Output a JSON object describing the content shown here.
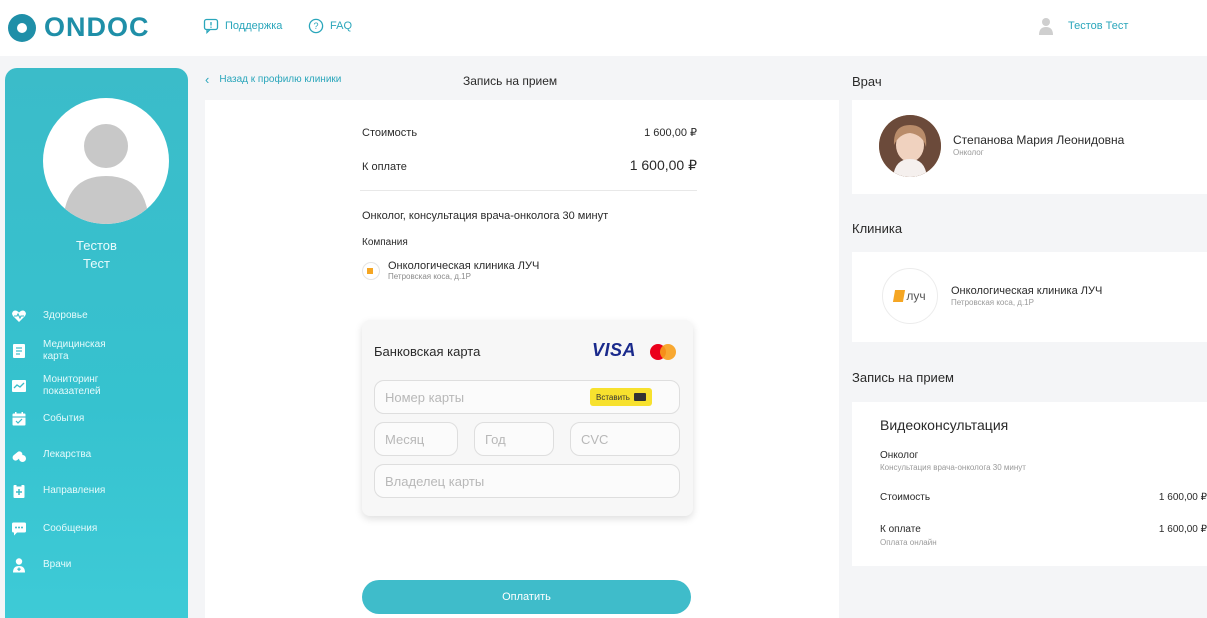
{
  "header": {
    "logo": "ONDOC",
    "support": "Поддержка",
    "faq": "FAQ",
    "user": "Тестов Тест"
  },
  "sidebar": {
    "user_first": "Тестов",
    "user_last": "Тест",
    "items": [
      {
        "label": "Здоровье",
        "icon": "heart-icon"
      },
      {
        "label": "Медицинская карта",
        "icon": "medical-card-icon"
      },
      {
        "label": "Мониторинг показателей",
        "icon": "monitoring-icon"
      },
      {
        "label": "События",
        "icon": "calendar-icon"
      },
      {
        "label": "Лекарства",
        "icon": "pills-icon"
      },
      {
        "label": "Направления",
        "icon": "clipboard-icon"
      },
      {
        "label": "Сообщения",
        "icon": "chat-icon"
      },
      {
        "label": "Врачи",
        "icon": "doctor-icon"
      }
    ]
  },
  "center": {
    "back": "Назад к профилю клиники",
    "title": "Запись на прием",
    "cost_label": "Стоимость",
    "cost_value": "1 600,00 ₽",
    "pay_label": "К оплате",
    "pay_value": "1 600,00 ₽",
    "service": "Онколог, консультация врача-онколога 30 минут",
    "company_label": "Компания",
    "company_name": "Онкологическая клиника ЛУЧ",
    "company_address": "Петровская коса, д.1Р",
    "bank_card": {
      "title": "Банковская карта",
      "brand": "VISA",
      "number_placeholder": "Номер карты",
      "paste": "Вставить",
      "month_placeholder": "Месяц",
      "year_placeholder": "Год",
      "cvc_placeholder": "CVC",
      "owner_placeholder": "Владелец карты"
    },
    "pay_button": "Оплатить"
  },
  "right": {
    "doctor_title": "Врач",
    "doctor_name": "Степанова Мария Леонидовна",
    "doctor_spec": "Онколог",
    "clinic_title": "Клиника",
    "clinic_logo_text": "луч",
    "clinic_name": "Онкологическая клиника ЛУЧ",
    "clinic_address": "Петровская коса, д.1Р",
    "appointment_title": "Запись на прием",
    "appointment_type": "Видеоконсультация",
    "specialty": "Онколог",
    "service": "Консультация врача-онколога 30 минут",
    "cost_label": "Стоимость",
    "cost_value": "1 600,00 ₽",
    "pay_label": "К оплате",
    "pay_value": "1 600,00 ₽",
    "pay_note": "Оплата онлайн"
  },
  "colors": {
    "accent": "#2aa6bb",
    "sidebar": "#3bbcc9",
    "pay_button": "#3fbcca"
  }
}
